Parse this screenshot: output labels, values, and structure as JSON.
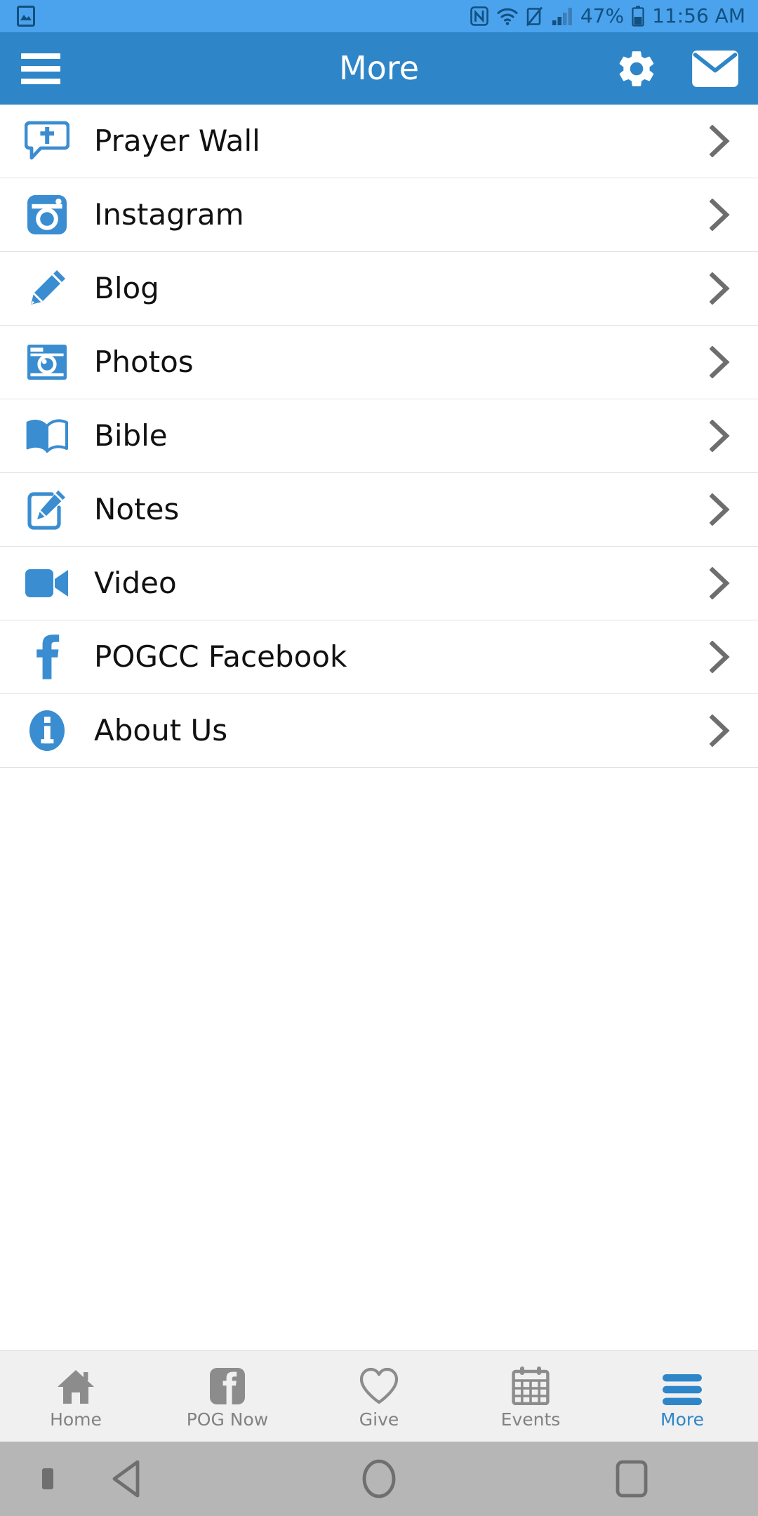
{
  "status_bar": {
    "background_color": "#4ba3ee",
    "icon_color": "#12507f",
    "left_icons": [
      "image-photo-icon"
    ],
    "right_icons": [
      "nfc-icon",
      "wifi-icon",
      "vibrate-off-icon",
      "cellular-signal-icon"
    ],
    "battery_percent": "47%",
    "battery_icon": "battery-icon",
    "time": "11:56 AM"
  },
  "app_bar": {
    "background_color": "#2e86c8",
    "menu_icon": "hamburger-menu-icon",
    "title": "More",
    "actions": [
      {
        "name": "settings",
        "icon": "gear-icon"
      },
      {
        "name": "messages",
        "icon": "envelope-icon"
      }
    ]
  },
  "menu": {
    "accent_color": "#2e86c8",
    "chevron_icon": "chevron-right-icon",
    "items": [
      {
        "label": "Prayer Wall",
        "icon": "prayer-bubble-cross-icon"
      },
      {
        "label": "Instagram",
        "icon": "instagram-icon"
      },
      {
        "label": "Blog",
        "icon": "pencil-icon"
      },
      {
        "label": "Photos",
        "icon": "camera-icon"
      },
      {
        "label": "Bible",
        "icon": "open-book-icon"
      },
      {
        "label": "Notes",
        "icon": "note-edit-icon"
      },
      {
        "label": "Video",
        "icon": "video-camera-icon"
      },
      {
        "label": "POGCC Facebook",
        "icon": "facebook-f-icon"
      },
      {
        "label": "About Us",
        "icon": "info-circle-icon"
      }
    ]
  },
  "tab_bar": {
    "background_color": "#f0f0f0",
    "inactive_color": "#828282",
    "active_color": "#2e86c8",
    "tabs": [
      {
        "label": "Home",
        "icon": "house-icon",
        "active": false
      },
      {
        "label": "POG Now",
        "icon": "facebook-icon",
        "active": false
      },
      {
        "label": "Give",
        "icon": "heart-icon",
        "active": false
      },
      {
        "label": "Events",
        "icon": "calendar-icon",
        "active": false
      },
      {
        "label": "More",
        "icon": "hamburger-icon",
        "active": true
      }
    ]
  },
  "android_nav": {
    "background_color": "#b6b6b6",
    "buttons": [
      "back-triangle-icon",
      "home-circle-icon",
      "recents-square-icon"
    ]
  }
}
